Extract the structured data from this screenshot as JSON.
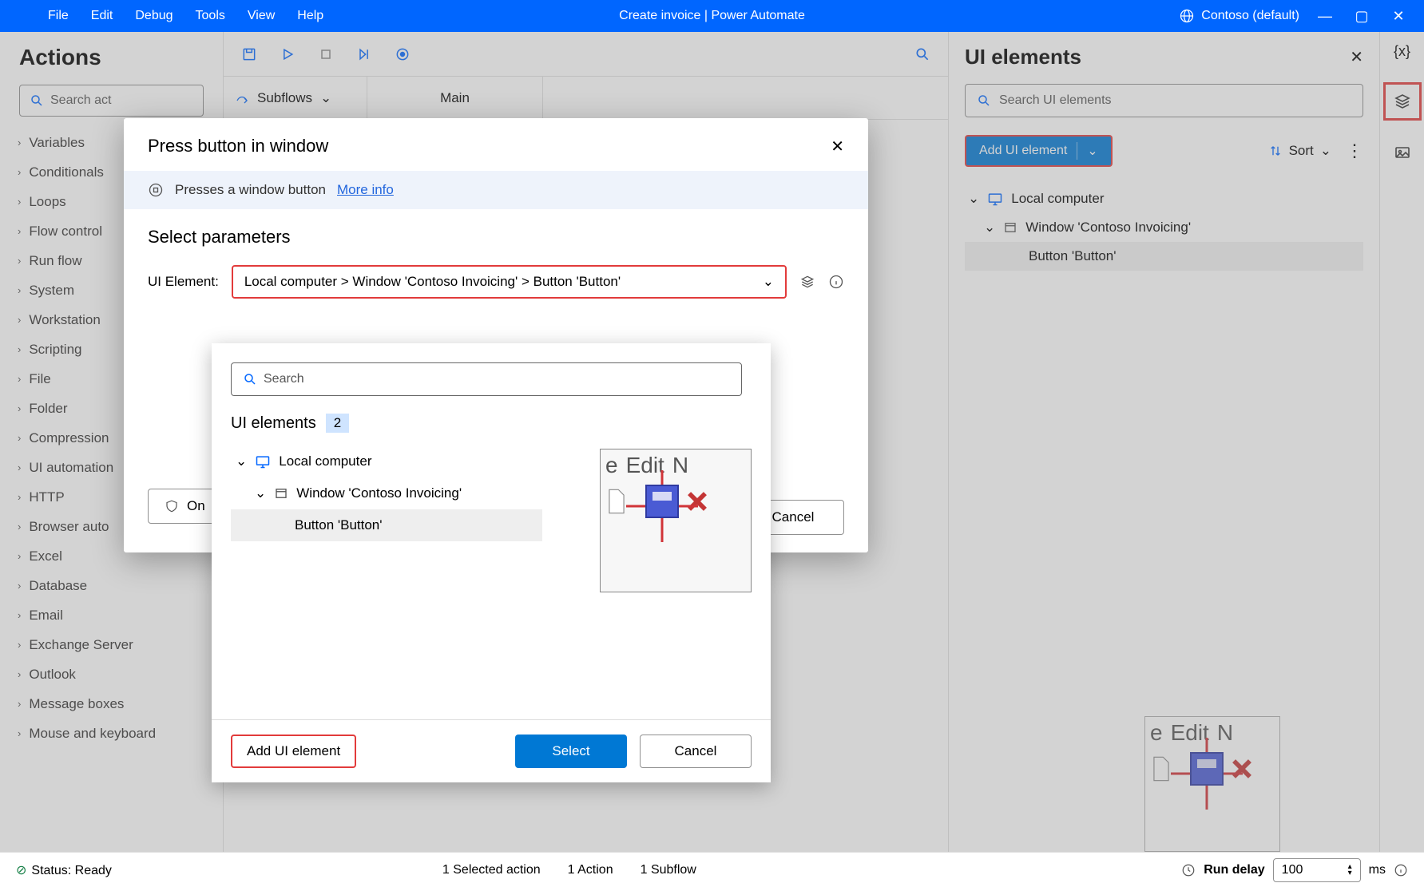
{
  "titlebar": {
    "menus": [
      "File",
      "Edit",
      "Debug",
      "Tools",
      "View",
      "Help"
    ],
    "center": "Create invoice | Power Automate",
    "env": "Contoso (default)"
  },
  "actions": {
    "title": "Actions",
    "search_placeholder": "Search act",
    "items": [
      "Variables",
      "Conditionals",
      "Loops",
      "Flow control",
      "Run flow",
      "System",
      "Workstation",
      "Scripting",
      "File",
      "Folder",
      "Compression",
      "UI automation",
      "HTTP",
      "Browser auto",
      "Excel",
      "Database",
      "Email",
      "Exchange Server",
      "Outlook",
      "Message boxes",
      "Mouse and keyboard"
    ]
  },
  "subflow": {
    "label": "Subflows",
    "main_tab": "Main"
  },
  "ui_panel": {
    "title": "UI elements",
    "search_placeholder": "Search UI elements",
    "add_btn": "Add UI element",
    "sort": "Sort",
    "tree": {
      "root": "Local computer",
      "window": "Window 'Contoso Invoicing'",
      "leaf": "Button 'Button'"
    }
  },
  "dialog": {
    "title": "Press button in window",
    "info": "Presses a window button",
    "more": "More info",
    "section": "Select parameters",
    "field_label": "UI Element:",
    "field_value": "Local computer > Window 'Contoso Invoicing' > Button 'Button'",
    "on_error": "On",
    "cancel": "Cancel"
  },
  "dialog2": {
    "search_placeholder": "Search",
    "count_label": "UI elements",
    "count": "2",
    "tree": {
      "root": "Local computer",
      "window": "Window 'Contoso Invoicing'",
      "leaf": "Button 'Button'"
    },
    "add": "Add UI element",
    "select": "Select",
    "cancel": "Cancel",
    "thumb_text": [
      "e",
      "Edit",
      "N"
    ]
  },
  "status": {
    "ready": "Status: Ready",
    "sel": "1 Selected action",
    "act": "1 Action",
    "sub": "1 Subflow",
    "delay_label": "Run delay",
    "delay_val": "100",
    "delay_unit": "ms"
  }
}
